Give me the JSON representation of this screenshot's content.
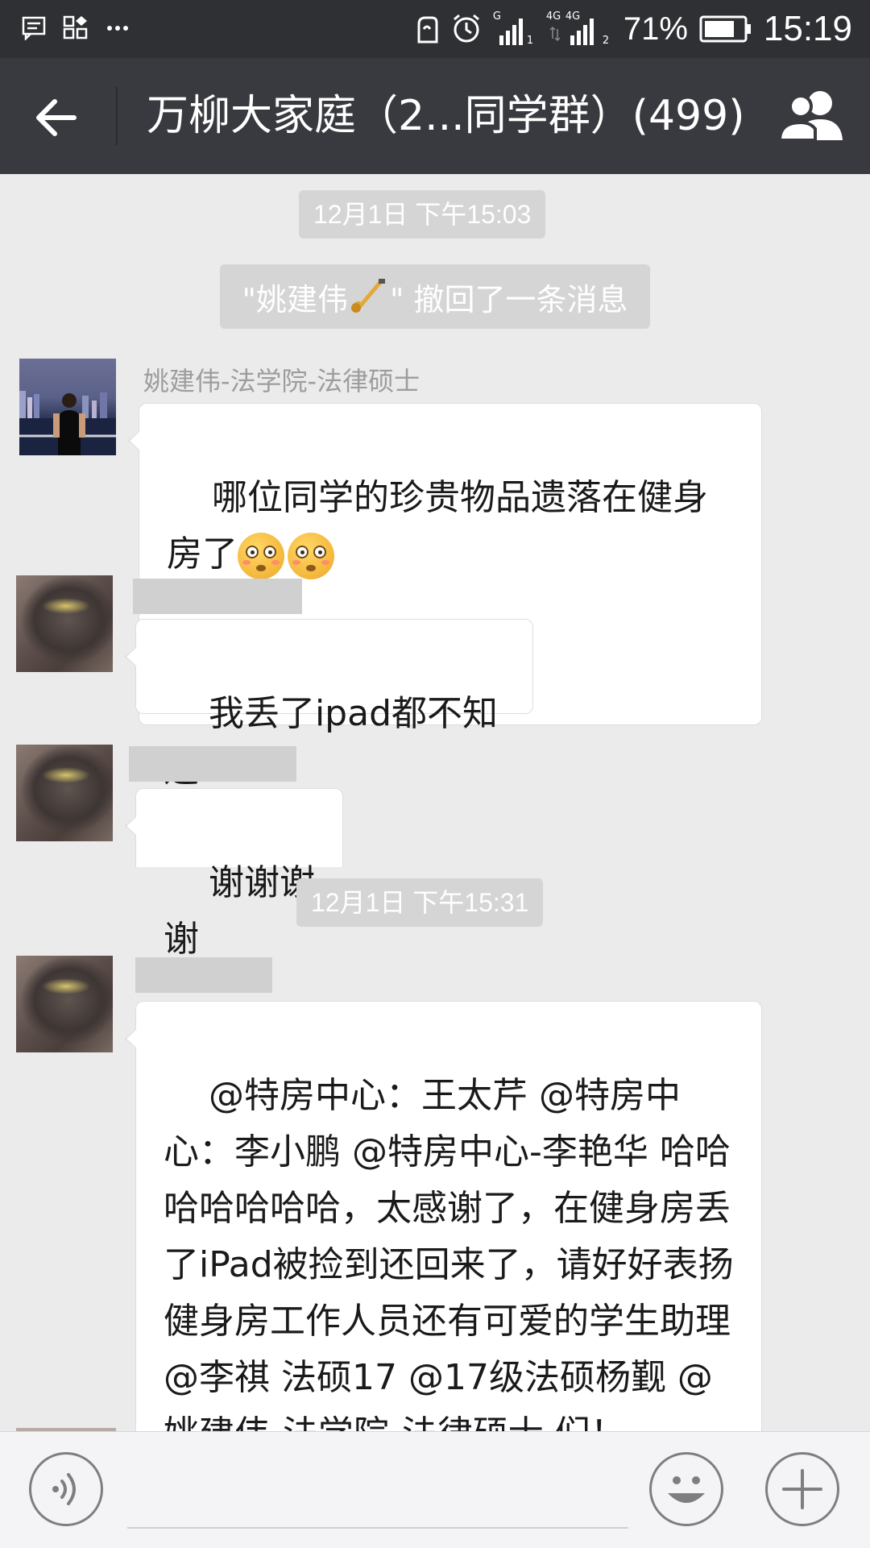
{
  "status_bar": {
    "battery_percent": "71%",
    "time": "15:19",
    "net1": "G",
    "net2": "4G",
    "net3": "4G",
    "sim1": "1",
    "sim2": "2"
  },
  "header": {
    "title": "万柳大家庭（2...同学群）(499)",
    "back_icon": "back-arrow-icon",
    "group_icon": "group-members-icon"
  },
  "chat": {
    "timestamps": [
      "12月1日 下午15:03",
      "12月1日 下午15:31"
    ],
    "recall_notice": {
      "prefix": "\"姚建伟",
      "suffix": "\" 撤回了一条消息"
    },
    "messages": [
      {
        "sender": "姚建伟-法学院-法律硕士",
        "text": "哪位同学的珍贵物品遗落在健身房了"
      },
      {
        "sender": "",
        "text": "我丢了ipad都不知道"
      },
      {
        "sender": "",
        "text": "谢谢谢谢"
      },
      {
        "sender": "",
        "text": "@特房中心：王太芹 @特房中心：李小鹏 @特房中心-李艳华 哈哈哈哈哈哈哈，太感谢了，在健身房丢了iPad被捡到还回来了，请好好表扬健身房工作人员还有可爱的学生助理@李祺 法硕17 @17级法硕杨觐 @姚建伟-法学院-法律硕士 们！"
      }
    ]
  },
  "input_bar": {
    "voice_icon": "voice-input-icon",
    "emoji_icon": "emoji-icon",
    "plus_icon": "plus-icon"
  },
  "colors": {
    "status_bar": "#2f3033",
    "title_bar": "#393a3f",
    "chat_bg": "#ebebeb",
    "bubble": "#ffffff",
    "badge": "#d5d5d5"
  }
}
